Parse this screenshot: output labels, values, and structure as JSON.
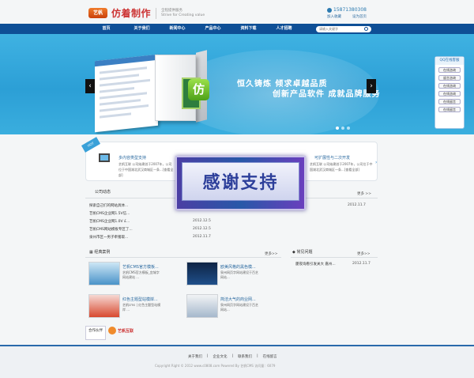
{
  "header": {
    "logo_badge": "艺帆",
    "logo_title": "仿着制作",
    "logo_slogan_cn": "全程提供服务",
    "logo_slogan_en": "Strive for Creating value",
    "phone": "15871380308",
    "favorite_link": "加入收藏",
    "homepage_link": "设为首页"
  },
  "nav": {
    "items": [
      "首页",
      "关于我们",
      "新闻中心",
      "产品中心",
      "资料下载",
      "人才招聘"
    ],
    "search_placeholder": "请输入关键字"
  },
  "banner": {
    "logo_char": "仿",
    "line1": "恒久铸炼 倾求卓越品质",
    "line2": "创新产品软件 成就品牌服务",
    "prev": "‹",
    "next": "›"
  },
  "qq_panel": {
    "title": "QQ在线客服",
    "buttons": [
      "在线咨询",
      "留言咨询",
      "在线咨询",
      "在线咨询",
      "在线留言",
      "在线留言"
    ]
  },
  "features": {
    "hot_label": "HOT",
    "f1_title": "多内容类型支持",
    "f1_desc": "艺帆互联 公司始建创于2007年，公司位于中国湖北武汉商城区一条...[查看全部]",
    "f3_title": "可扩展性与二次开发",
    "f3_desc": "艺帆互联 公司始建创于2007年，公司位于中国湖北武汉商城区一条...[查看全部]",
    "next": "›"
  },
  "overlay": {
    "text": "感谢支持"
  },
  "news": {
    "title": "公司动态",
    "more": "更多 >>",
    "items": [
      {
        "title": "探索自己们的网站具体...",
        "date": "2012.11.7"
      },
      {
        "title": "艺帆CMS企业网1.5V信...",
        "date": ""
      },
      {
        "title": "艺帆CMS企业网1.0V £...",
        "date": "2012.12.5"
      },
      {
        "title": "艺帆CMS网站模板专区了...",
        "date": "2012.12.5"
      },
      {
        "title": "泉州市区一男子牵猪取...",
        "date": "2012.11.7"
      }
    ]
  },
  "cases": {
    "title": "经典案例",
    "more": "更多>>",
    "items": [
      {
        "title": "艺帆CMS官方模板...",
        "desc": "艺帆CMS官方模板_宜城字网站建站 ..."
      },
      {
        "title": "欧美风格的黑色模...",
        "desc": "泉州网页字网站建设于百艺网站..."
      },
      {
        "title": "红色主题型站模岸...",
        "desc": "艺帆cms | 红色主题型站模岸 ..."
      },
      {
        "title": "简洁大气的商业网...",
        "desc": "泉州网页字网站建设于百艺网站..."
      }
    ]
  },
  "faq": {
    "title": "常见问题",
    "more": "更多>>",
    "items": [
      {
        "title": "厦夜询看引发关大 嘉州...",
        "date": "2012.11.7"
      }
    ]
  },
  "partners": {
    "label": "合作伙伴",
    "logo_text": "艺帆互联"
  },
  "footer": {
    "links": [
      "关于我们",
      "|",
      "企业文化",
      "|",
      "联系我们",
      "|",
      "在线留言"
    ],
    "copyright": "Copyright Right © 2012 www.c0808.com Powered By 艺帆CMS    访问量：6079"
  }
}
